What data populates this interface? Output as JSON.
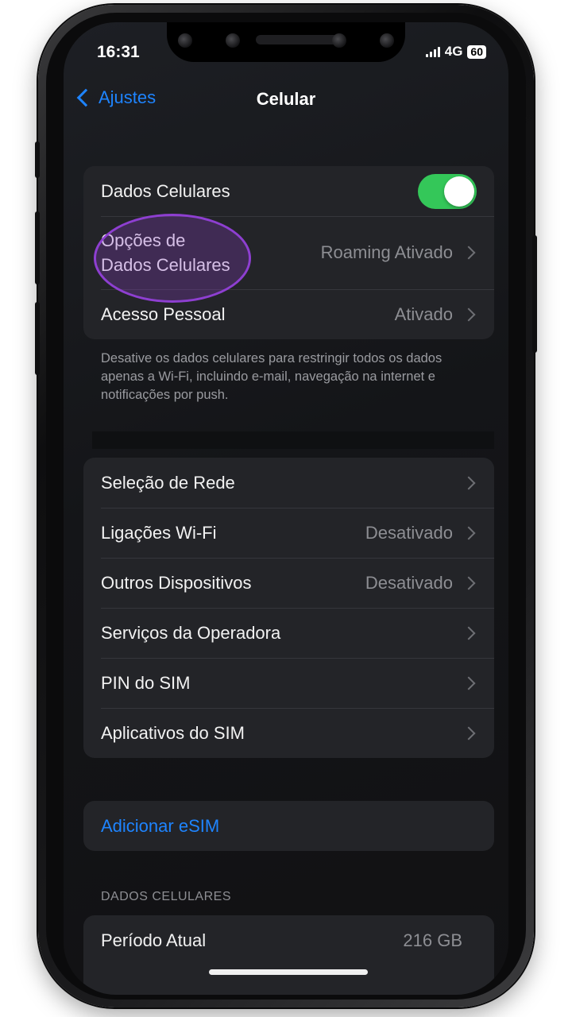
{
  "status": {
    "time": "16:31",
    "network": "4G",
    "battery": "60"
  },
  "nav": {
    "back_label": "Ajustes",
    "title": "Celular"
  },
  "group1": {
    "cellular_data": {
      "label": "Dados Celulares",
      "toggle_on": true
    },
    "data_options": {
      "label_line1": "Opções de",
      "label_line2": "Dados Celulares",
      "value": "Roaming Ativado"
    },
    "hotspot": {
      "label": "Acesso Pessoal",
      "value": "Ativado"
    }
  },
  "footnote": "Desative os dados celulares para restringir todos os dados apenas a Wi-Fi, incluindo e-mail, navegação na internet e notificações por push.",
  "group2": {
    "rows": [
      {
        "label": "Seleção de Rede",
        "value": ""
      },
      {
        "label": "Ligações Wi-Fi",
        "value": "Desativado"
      },
      {
        "label": "Outros Dispositivos",
        "value": "Desativado"
      },
      {
        "label": "Serviços da Operadora",
        "value": ""
      },
      {
        "label": "PIN do SIM",
        "value": ""
      },
      {
        "label": "Aplicativos do SIM",
        "value": ""
      }
    ]
  },
  "esim": {
    "label": "Adicionar eSIM"
  },
  "usage": {
    "header": "DADOS CELULARES",
    "current_period": {
      "label": "Período Atual",
      "value": "216 GB"
    }
  },
  "colors": {
    "accent": "#1e84ff",
    "toggle_on": "#34c759",
    "highlight": "#8e3fd1"
  }
}
